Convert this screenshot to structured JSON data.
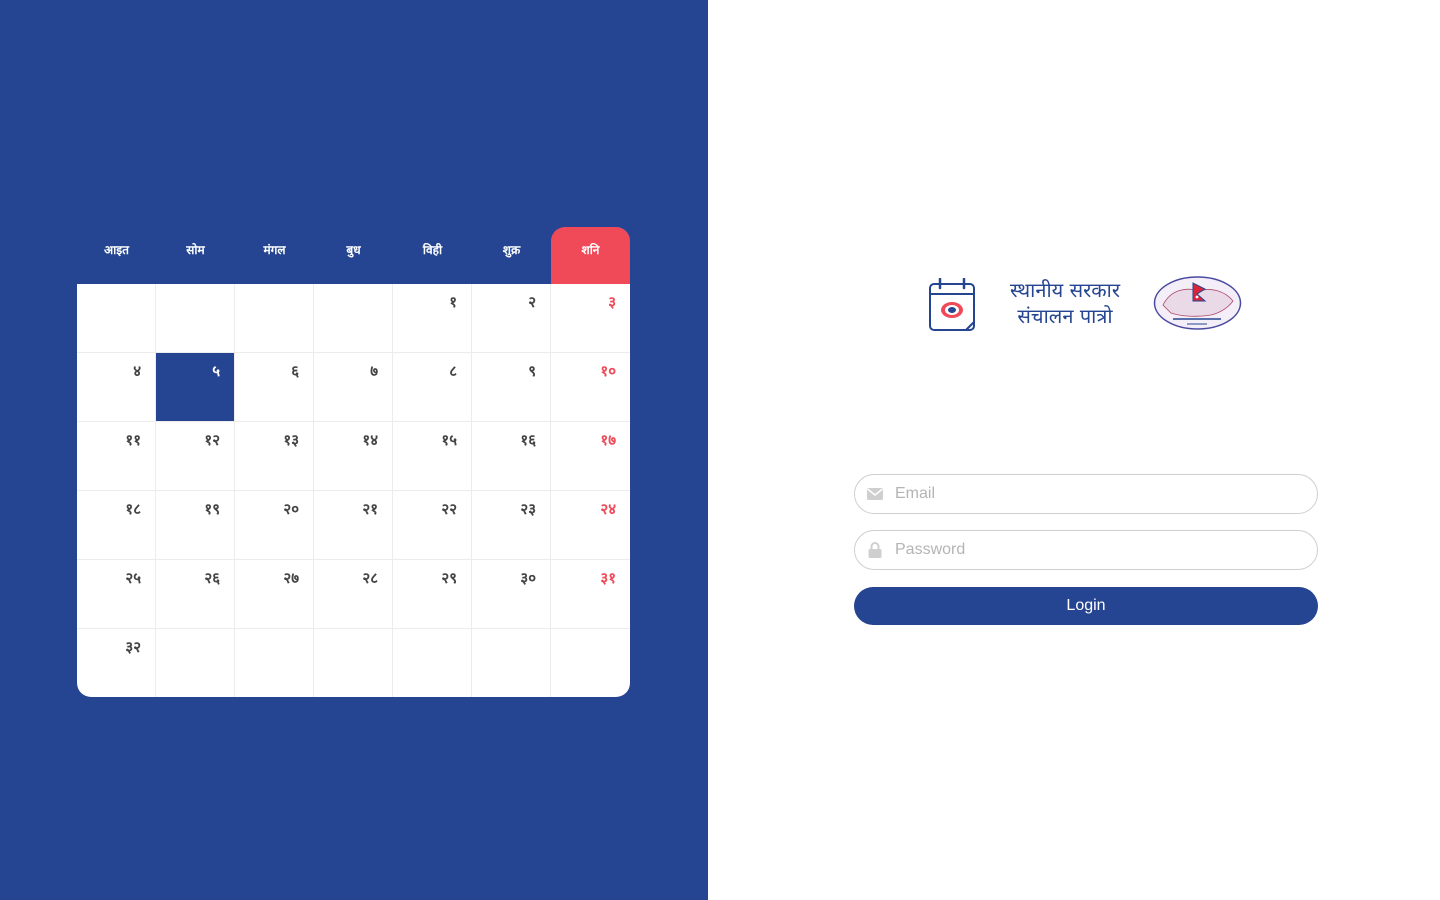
{
  "calendar": {
    "weekdays": [
      "आइत",
      "सोम",
      "मंगल",
      "बुध",
      "विही",
      "शुक्र",
      "शनि"
    ],
    "weeks": [
      [
        "",
        "",
        "",
        "",
        "१",
        "२",
        "३"
      ],
      [
        "४",
        "५",
        "६",
        "७",
        "८",
        "९",
        "१०"
      ],
      [
        "११",
        "१२",
        "१३",
        "१४",
        "१५",
        "१६",
        "१७"
      ],
      [
        "१८",
        "१९",
        "२०",
        "२१",
        "२२",
        "२३",
        "२४"
      ],
      [
        "२५",
        "२६",
        "२७",
        "२८",
        "२९",
        "३०",
        "३१"
      ],
      [
        "३२",
        "",
        "",
        "",
        "",
        "",
        ""
      ]
    ],
    "today": "५",
    "colors": {
      "primary": "#254592",
      "saturday": "#f04a58"
    }
  },
  "brand": {
    "title_line1": "स्थानीय सरकार",
    "title_line2": "संचालन पात्रो"
  },
  "login": {
    "email_placeholder": "Email",
    "email_icon": "envelope-icon",
    "password_placeholder": "Password",
    "password_icon": "lock-icon",
    "button_label": "Login"
  }
}
